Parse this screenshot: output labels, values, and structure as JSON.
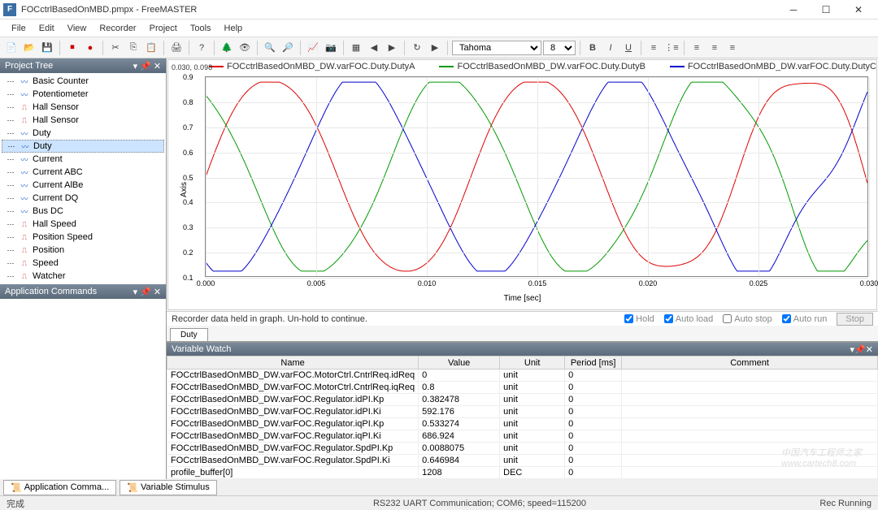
{
  "title": "FOCctrlBasedOnMBD.pmpx - FreeMASTER",
  "menu": [
    "File",
    "Edit",
    "View",
    "Recorder",
    "Project",
    "Tools",
    "Help"
  ],
  "font_name": "Tahoma",
  "font_size": "8",
  "tree_panel_title": "Project Tree",
  "tree": [
    {
      "label": "Basic Counter",
      "type": "wave"
    },
    {
      "label": "Potentiometer",
      "type": "wave"
    },
    {
      "label": "Hall Sensor",
      "type": "trig"
    },
    {
      "label": "Hall Sensor",
      "type": "trig"
    },
    {
      "label": "Duty",
      "type": "wave"
    },
    {
      "label": "Duty",
      "type": "wave",
      "sel": true
    },
    {
      "label": "Current",
      "type": "wave"
    },
    {
      "label": "Current ABC",
      "type": "wave"
    },
    {
      "label": "Current AlBe",
      "type": "wave"
    },
    {
      "label": "Current DQ",
      "type": "wave"
    },
    {
      "label": "Bus DC",
      "type": "wave"
    },
    {
      "label": "Hall Speed",
      "type": "trig"
    },
    {
      "label": "Position Speed",
      "type": "trig"
    },
    {
      "label": "Position",
      "type": "trig"
    },
    {
      "label": "Speed",
      "type": "trig"
    },
    {
      "label": "Watcher",
      "type": "trig"
    }
  ],
  "appcmd_title": "Application Commands",
  "chart_coord": "0.030, 0.098",
  "chart_data": {
    "type": "line",
    "title": "",
    "xlabel": "Time [sec]",
    "ylabel": "Axis",
    "xlim": [
      0,
      0.03
    ],
    "ylim": [
      0.1,
      0.9
    ],
    "xticks": [
      0,
      0.005,
      0.01,
      0.015,
      0.02,
      0.025,
      0.03
    ],
    "yticks": [
      0.1,
      0.2,
      0.3,
      0.4,
      0.5,
      0.6,
      0.7,
      0.8,
      0.9
    ],
    "series": [
      {
        "name": "FOCctrlBasedOnMBD_DW.varFOC.Duty.DutyA",
        "color": "#dd0000"
      },
      {
        "name": "FOCctrlBasedOnMBD_DW.varFOC.Duty.DutyB",
        "color": "#009900"
      },
      {
        "name": "FOCctrlBasedOnMBD_DW.varFOC.Duty.DutyC",
        "color": "#0000cc"
      }
    ],
    "note": "Three-phase PWM duty signals, approximately sinusoidal with ~0.012s period, 120° phase offset, amplitude ~0.1–0.9, with some noise/switching artifacts especially in the last third of the window."
  },
  "chart_msg": "Recorder data held in graph. Un-hold to continue.",
  "chart_options": {
    "hold": "Hold",
    "autoload": "Auto load",
    "autostop": "Auto stop",
    "autorun": "Auto run",
    "stop": "Stop"
  },
  "chart_tab": "Duty",
  "varwatch_title": "Variable Watch",
  "vw_cols": [
    "Name",
    "Value",
    "Unit",
    "Period [ms]",
    "Comment"
  ],
  "vw_rows": [
    {
      "name": "FOCctrlBasedOnMBD_DW.varFOC.MotorCtrl.CntrlReq.idReq",
      "value": "0",
      "unit": "unit",
      "period": "0",
      "comment": ""
    },
    {
      "name": "FOCctrlBasedOnMBD_DW.varFOC.MotorCtrl.CntrlReq.iqReq",
      "value": "0.8",
      "unit": "unit",
      "period": "0",
      "comment": ""
    },
    {
      "name": "FOCctrlBasedOnMBD_DW.varFOC.Regulator.idPI.Kp",
      "value": "0.382478",
      "unit": "unit",
      "period": "0",
      "comment": ""
    },
    {
      "name": "FOCctrlBasedOnMBD_DW.varFOC.Regulator.idPI.Ki",
      "value": "592.176",
      "unit": "unit",
      "period": "0",
      "comment": ""
    },
    {
      "name": "FOCctrlBasedOnMBD_DW.varFOC.Regulator.iqPI.Kp",
      "value": "0.533274",
      "unit": "unit",
      "period": "0",
      "comment": ""
    },
    {
      "name": "FOCctrlBasedOnMBD_DW.varFOC.Regulator.iqPI.Ki",
      "value": "686.924",
      "unit": "unit",
      "period": "0",
      "comment": ""
    },
    {
      "name": "FOCctrlBasedOnMBD_DW.varFOC.Regulator.SpdPI.Kp",
      "value": "0.0088075",
      "unit": "unit",
      "period": "0",
      "comment": ""
    },
    {
      "name": "FOCctrlBasedOnMBD_DW.varFOC.Regulator.SpdPI.Ki",
      "value": "0.646984",
      "unit": "unit",
      "period": "0",
      "comment": ""
    },
    {
      "name": "profile_buffer[0]",
      "value": "1208",
      "unit": "DEC",
      "period": "0",
      "comment": ""
    }
  ],
  "bottom_tabs": [
    "Application Comma...",
    "Variable Stimulus"
  ],
  "status": {
    "left": "完成",
    "center": "RS232 UART Communication; COM6; speed=115200",
    "right": "Rec Running"
  },
  "watermark": {
    "l1": "中国汽车工程师之家",
    "l2": "www.cartech8.com"
  }
}
